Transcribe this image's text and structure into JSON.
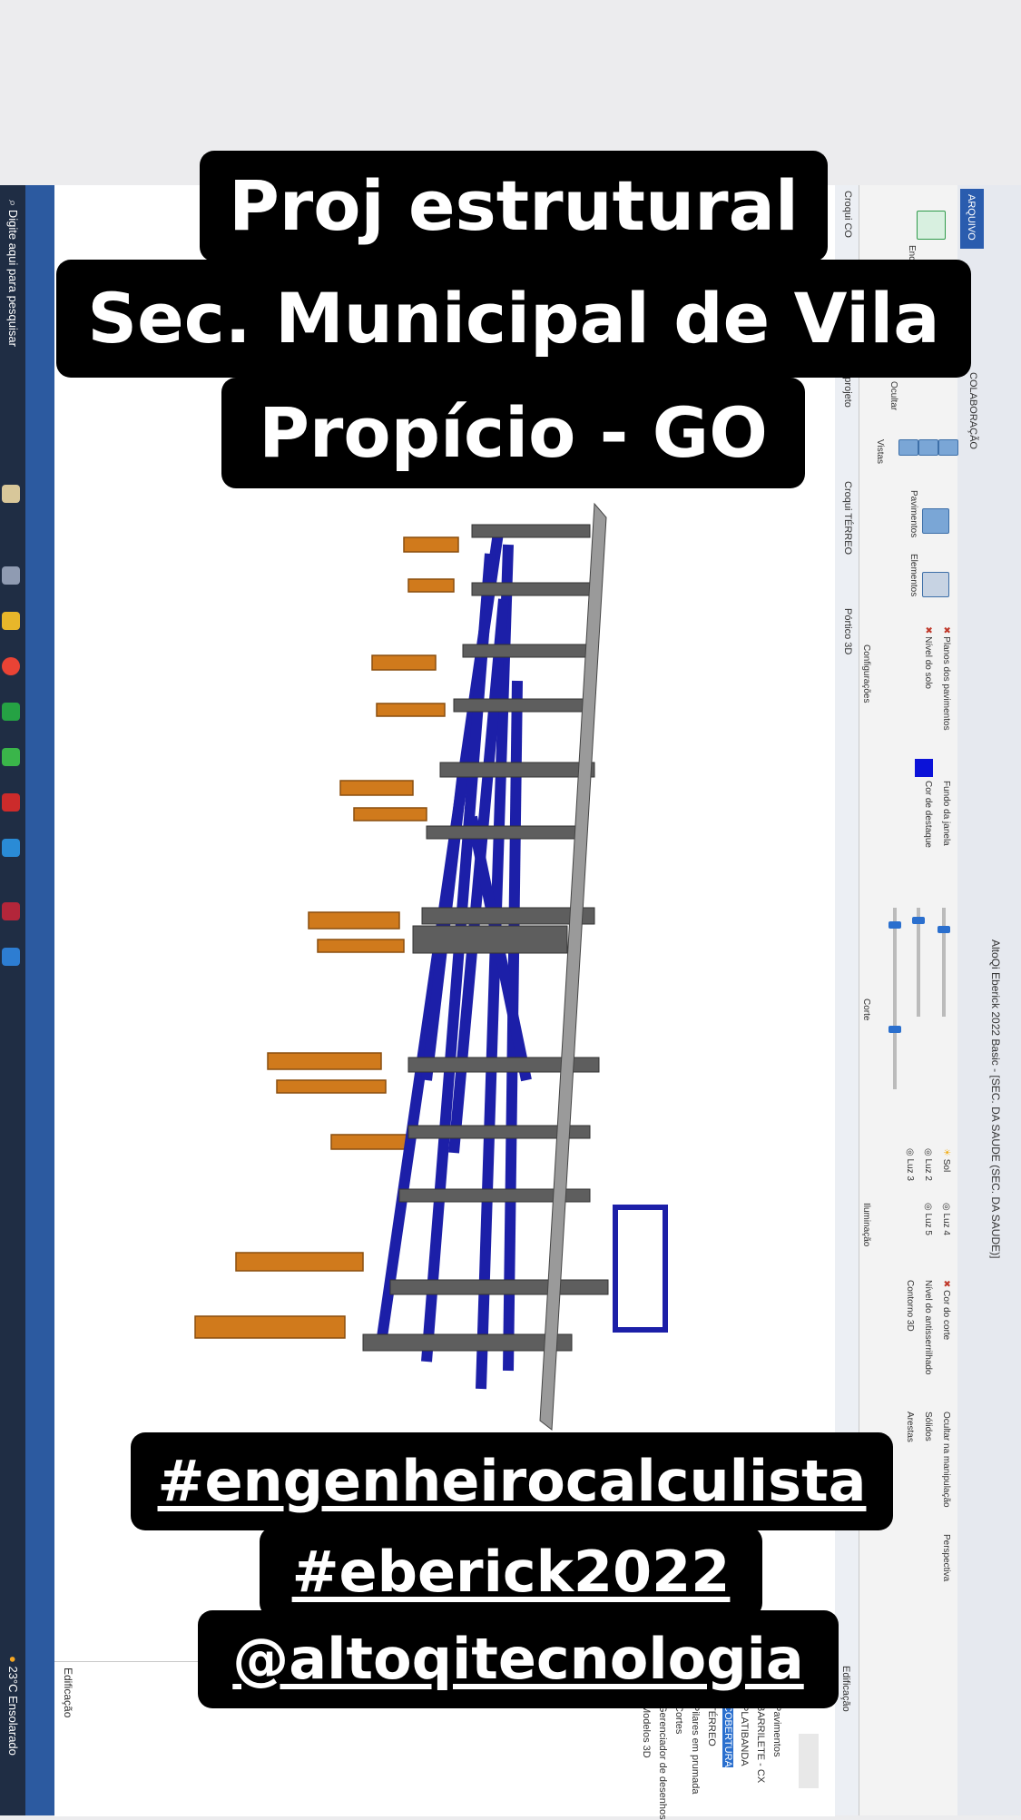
{
  "window": {
    "title": "AltoQi Eberick 2022 Basic - [SEC. DA SAUDE (SEC. DA SAUDE)]"
  },
  "ribbon": {
    "tab_arquivo": "ARQUIVO",
    "tab_colaboracao": "COLABORAÇÃO",
    "btn_enquadrar": "Enquadrar 3D",
    "btn_ocultar": "Ocultar",
    "grp_vistas": "Vistas",
    "btn_pavimentos": "Pavimentos",
    "btn_elementos": "Elementos",
    "grp_configuracoes": "Configurações",
    "chk_planos": "Planos dos pavimentos",
    "chk_nivel_solo": "Nível do solo",
    "fundo_janela": "Fundo da janela",
    "cor_destaque": "Cor de destaque",
    "accent_color": "#0b12d8",
    "grp_corte": "Corte",
    "luz_sol": "Sol",
    "luz_4": "Luz 4",
    "luz_2": "Luz 2",
    "luz_5": "Luz 5",
    "luz_3": "Luz 3",
    "grp_iluminacao": "Iluminação",
    "cor_corte": "Cor do corte",
    "nivel_antiserrilhado": "Nível do antisserrilhado",
    "contorno_3d": "Contorno 3D",
    "ocultar_manipulacao": "Ocultar na manipulação",
    "perspectiva": "Perspectiva",
    "solidos": "Sólidos",
    "arestas": "Arestas",
    "grp_edificacao": "Edificação"
  },
  "doc_tabs": {
    "tab1": "Croqui CO",
    "tab2": "Croqui TÉRREO",
    "tab3": "Pórtico 3D",
    "tab_projeto": "do projeto"
  },
  "tree": {
    "title": "Edificação",
    "items": [
      "Pavimentos",
      "BARRILETE - CX",
      "PLATIBANDA",
      "COBERTURA",
      "TÉRREO",
      "Pilares em prumada",
      "Cortes",
      "Gerenciador de desenhos",
      "Modelos 3D"
    ],
    "left_label": "Edificação"
  },
  "taskbar": {
    "search_placeholder": "Digite aqui para pesquisar",
    "weather": "23°C Ensolarado"
  },
  "captions": {
    "title_line1": "Proj estrutural",
    "title_line2": "Sec. Municipal de Vila",
    "title_line3": "Propício - GO",
    "tag1": "#engenheirocalculista",
    "tag2": "#eberick2022",
    "tag3": "@altoqitecnologia"
  },
  "model_colors": {
    "frame": "#1c1fa8",
    "pillars": "#d07a1c",
    "beams": "#6a6a6a"
  }
}
